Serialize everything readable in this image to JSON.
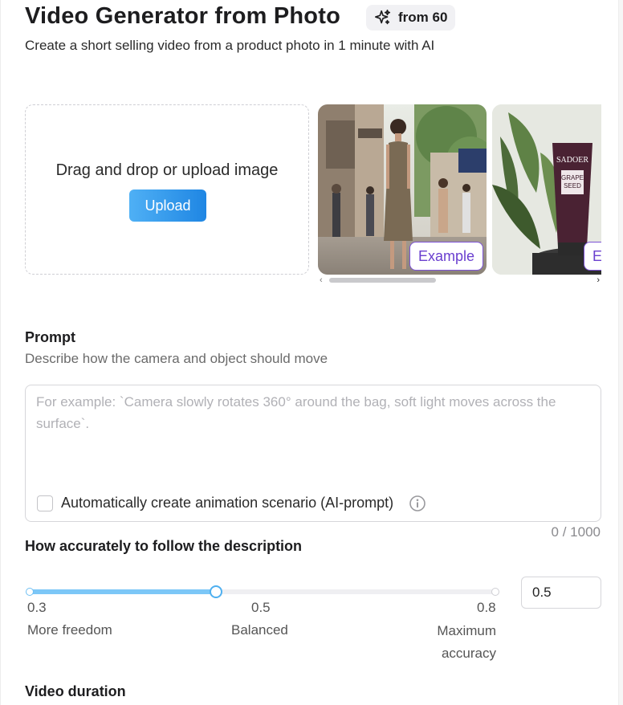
{
  "header": {
    "title": "Video Generator from Photo",
    "cost_badge": {
      "icon": "sparkle-icon",
      "label": "from 60"
    },
    "subtitle": "Create a short selling video from a product photo in 1 minute with AI"
  },
  "upload": {
    "drop_text": "Drag and drop or upload image",
    "button_label": "Upload",
    "button_color": "#2f94ea"
  },
  "examples": {
    "items": [
      {
        "label": "Example",
        "image": "woman in brown dress on a city street"
      },
      {
        "label": "E",
        "image": "purple tube of SADOER grape seed cream beside a plant"
      }
    ],
    "product_brand": "SADOER",
    "product_line": [
      "GRAPE",
      "SEED"
    ],
    "accent_color": "#7d53d6"
  },
  "prompt": {
    "label": "Prompt",
    "hint": "Describe how the camera and object should move",
    "value": "",
    "placeholder": "For example: `Camera slowly rotates 360° around the bag, soft light moves across the surface`.",
    "ai_checkbox": {
      "label": "Automatically create animation scenario (AI-prompt)",
      "checked": false,
      "icon": "info-icon"
    },
    "counter": "0 / 1000"
  },
  "accuracy": {
    "label": "How accurately to follow the description",
    "min": 0.3,
    "max": 0.8,
    "value": 0.5,
    "value_text": "0.5",
    "ticks": [
      "0.3",
      "0.5",
      "0.8"
    ],
    "captions": [
      "More freedom",
      "Balanced",
      "Maximum accuracy"
    ],
    "fill_color": "#7cc7f7"
  },
  "duration": {
    "label": "Video duration"
  }
}
